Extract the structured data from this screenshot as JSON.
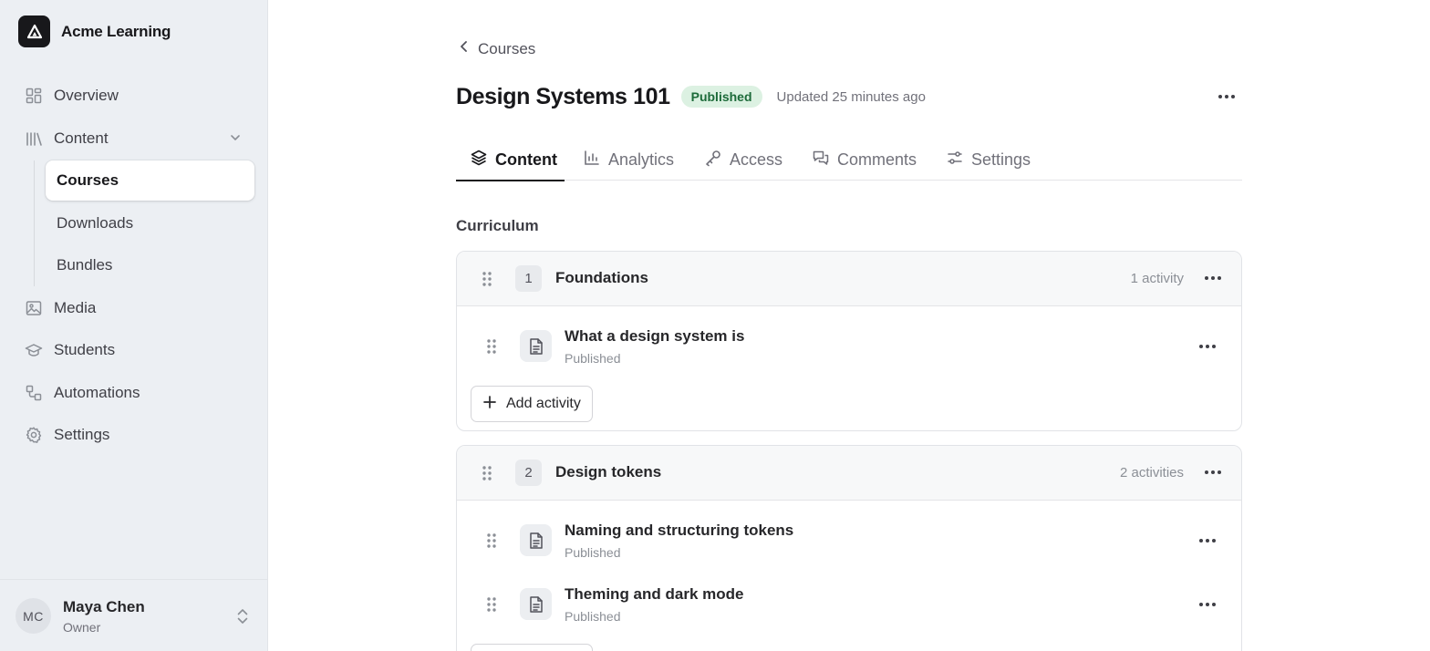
{
  "app": {
    "name": "Acme Learning"
  },
  "sidebar": {
    "items": [
      {
        "label": "Overview",
        "icon": "grid-icon"
      },
      {
        "label": "Content",
        "icon": "library-icon",
        "expanded": true
      },
      {
        "label": "Media",
        "icon": "image-icon"
      },
      {
        "label": "Students",
        "icon": "graduation-cap-icon"
      },
      {
        "label": "Automations",
        "icon": "workflow-icon"
      },
      {
        "label": "Settings",
        "icon": "gear-icon"
      }
    ],
    "content_children": [
      {
        "label": "Courses",
        "active": true
      },
      {
        "label": "Downloads"
      },
      {
        "label": "Bundles"
      }
    ]
  },
  "user": {
    "initials": "MC",
    "name": "Maya Chen",
    "role": "Owner"
  },
  "breadcrumb": {
    "label": "Courses"
  },
  "course": {
    "title": "Design Systems 101",
    "status": "Published",
    "updated": "Updated 25 minutes ago"
  },
  "tabs": [
    {
      "label": "Content",
      "icon": "layers-icon",
      "active": true
    },
    {
      "label": "Analytics",
      "icon": "bar-chart-icon"
    },
    {
      "label": "Access",
      "icon": "key-icon"
    },
    {
      "label": "Comments",
      "icon": "comments-icon"
    },
    {
      "label": "Settings",
      "icon": "sliders-icon"
    }
  ],
  "curriculum": {
    "title": "Curriculum",
    "add_activity_label": "Add activity",
    "modules": [
      {
        "number": "1",
        "title": "Foundations",
        "count": "1 activity",
        "activities": [
          {
            "title": "What a design system is",
            "status": "Published"
          }
        ]
      },
      {
        "number": "2",
        "title": "Design tokens",
        "count": "2 activities",
        "activities": [
          {
            "title": "Naming and structuring tokens",
            "status": "Published"
          },
          {
            "title": "Theming and dark mode",
            "status": "Published"
          }
        ]
      }
    ]
  },
  "colors": {
    "sidebar_bg": "#eceff3",
    "accent": "#18181b",
    "published_badge_bg": "#dcf1e2",
    "published_badge_text": "#1d6b3a"
  }
}
